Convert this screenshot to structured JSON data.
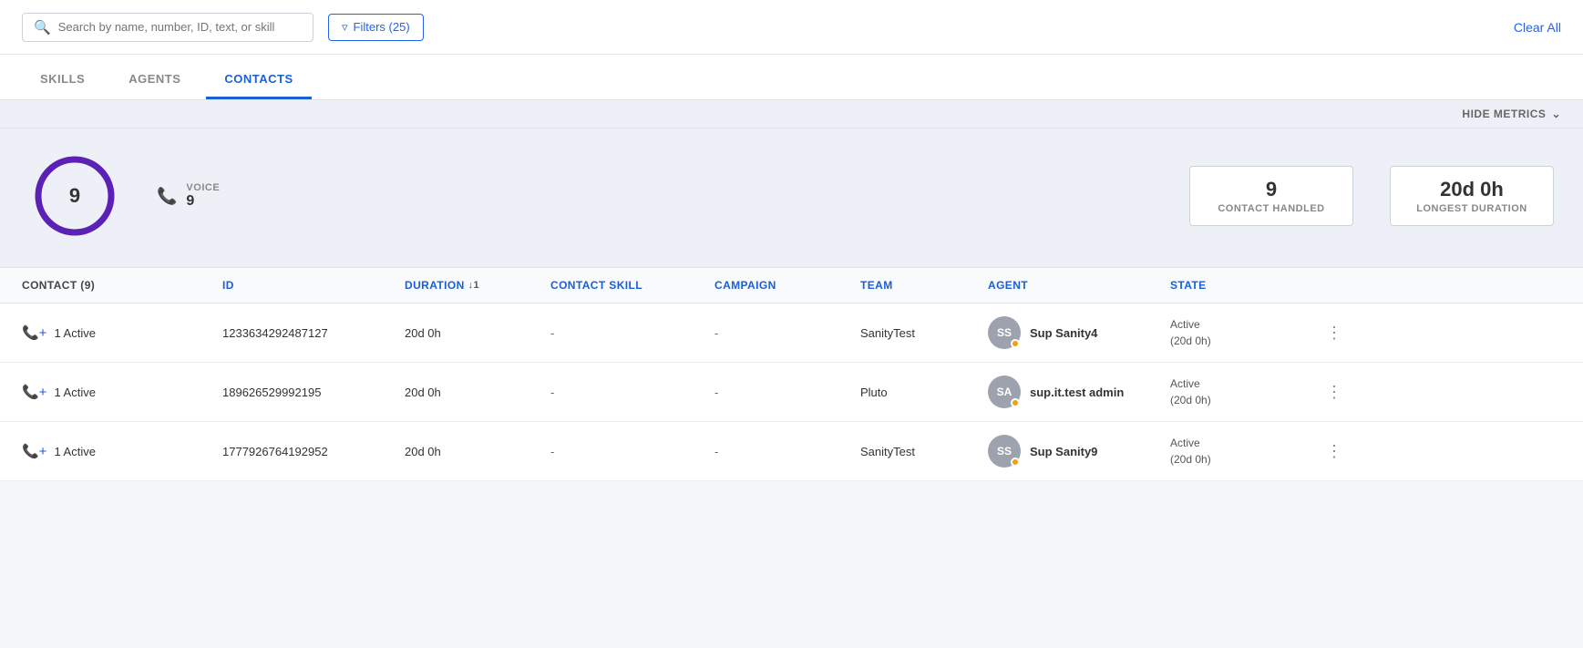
{
  "topbar": {
    "search_placeholder": "Search by name, number, ID, text, or skill",
    "filter_label": "Filters (25)",
    "clear_all_label": "Clear All"
  },
  "tabs": [
    {
      "id": "skills",
      "label": "SKILLS",
      "active": false
    },
    {
      "id": "agents",
      "label": "AGENTS",
      "active": false
    },
    {
      "id": "contacts",
      "label": "CONTACTS",
      "active": true
    }
  ],
  "metrics_header": {
    "hide_label": "HIDE METRICS"
  },
  "metrics": {
    "total": 9,
    "voice_label": "VOICE",
    "voice_count": 9,
    "contact_handled_count": 9,
    "contact_handled_label": "CONTACT HANDLED",
    "longest_duration": "20d 0h",
    "longest_duration_label": "LONGEST DURATION"
  },
  "table": {
    "columns": [
      {
        "id": "contact",
        "label": "CONTACT (9)",
        "sortable": false
      },
      {
        "id": "id",
        "label": "ID",
        "sortable": false
      },
      {
        "id": "duration",
        "label": "DURATION",
        "sortable": true,
        "sort_order": 1
      },
      {
        "id": "contact_skill",
        "label": "CONTACT SKILL",
        "sortable": false
      },
      {
        "id": "campaign",
        "label": "CAMPAIGN",
        "sortable": false
      },
      {
        "id": "team",
        "label": "TEAM",
        "sortable": false
      },
      {
        "id": "agent",
        "label": "AGENT",
        "sortable": false
      },
      {
        "id": "state",
        "label": "STATE",
        "sortable": false
      }
    ],
    "rows": [
      {
        "contact": "1 Active",
        "id": "1233634292487127",
        "duration": "20d 0h",
        "contact_skill": "-",
        "campaign": "-",
        "team": "SanityTest",
        "agent_initials": "SS",
        "agent_name": "Sup Sanity4",
        "state_line1": "Active",
        "state_line2": "(20d 0h)"
      },
      {
        "contact": "1 Active",
        "id": "189626529992195",
        "duration": "20d 0h",
        "contact_skill": "-",
        "campaign": "-",
        "team": "Pluto",
        "agent_initials": "SA",
        "agent_name": "sup.it.test admin",
        "state_line1": "Active",
        "state_line2": "(20d 0h)"
      },
      {
        "contact": "1 Active",
        "id": "1777926764192952",
        "duration": "20d 0h",
        "contact_skill": "-",
        "campaign": "-",
        "team": "SanityTest",
        "agent_initials": "SS",
        "agent_name": "Sup Sanity9",
        "state_line1": "Active",
        "state_line2": "(20d 0h)"
      }
    ]
  },
  "colors": {
    "accent": "#1a5fd8",
    "donut_stroke": "#5b21b6",
    "avatar_bg": "#9ca3af",
    "status_dot": "#f59e0b"
  }
}
